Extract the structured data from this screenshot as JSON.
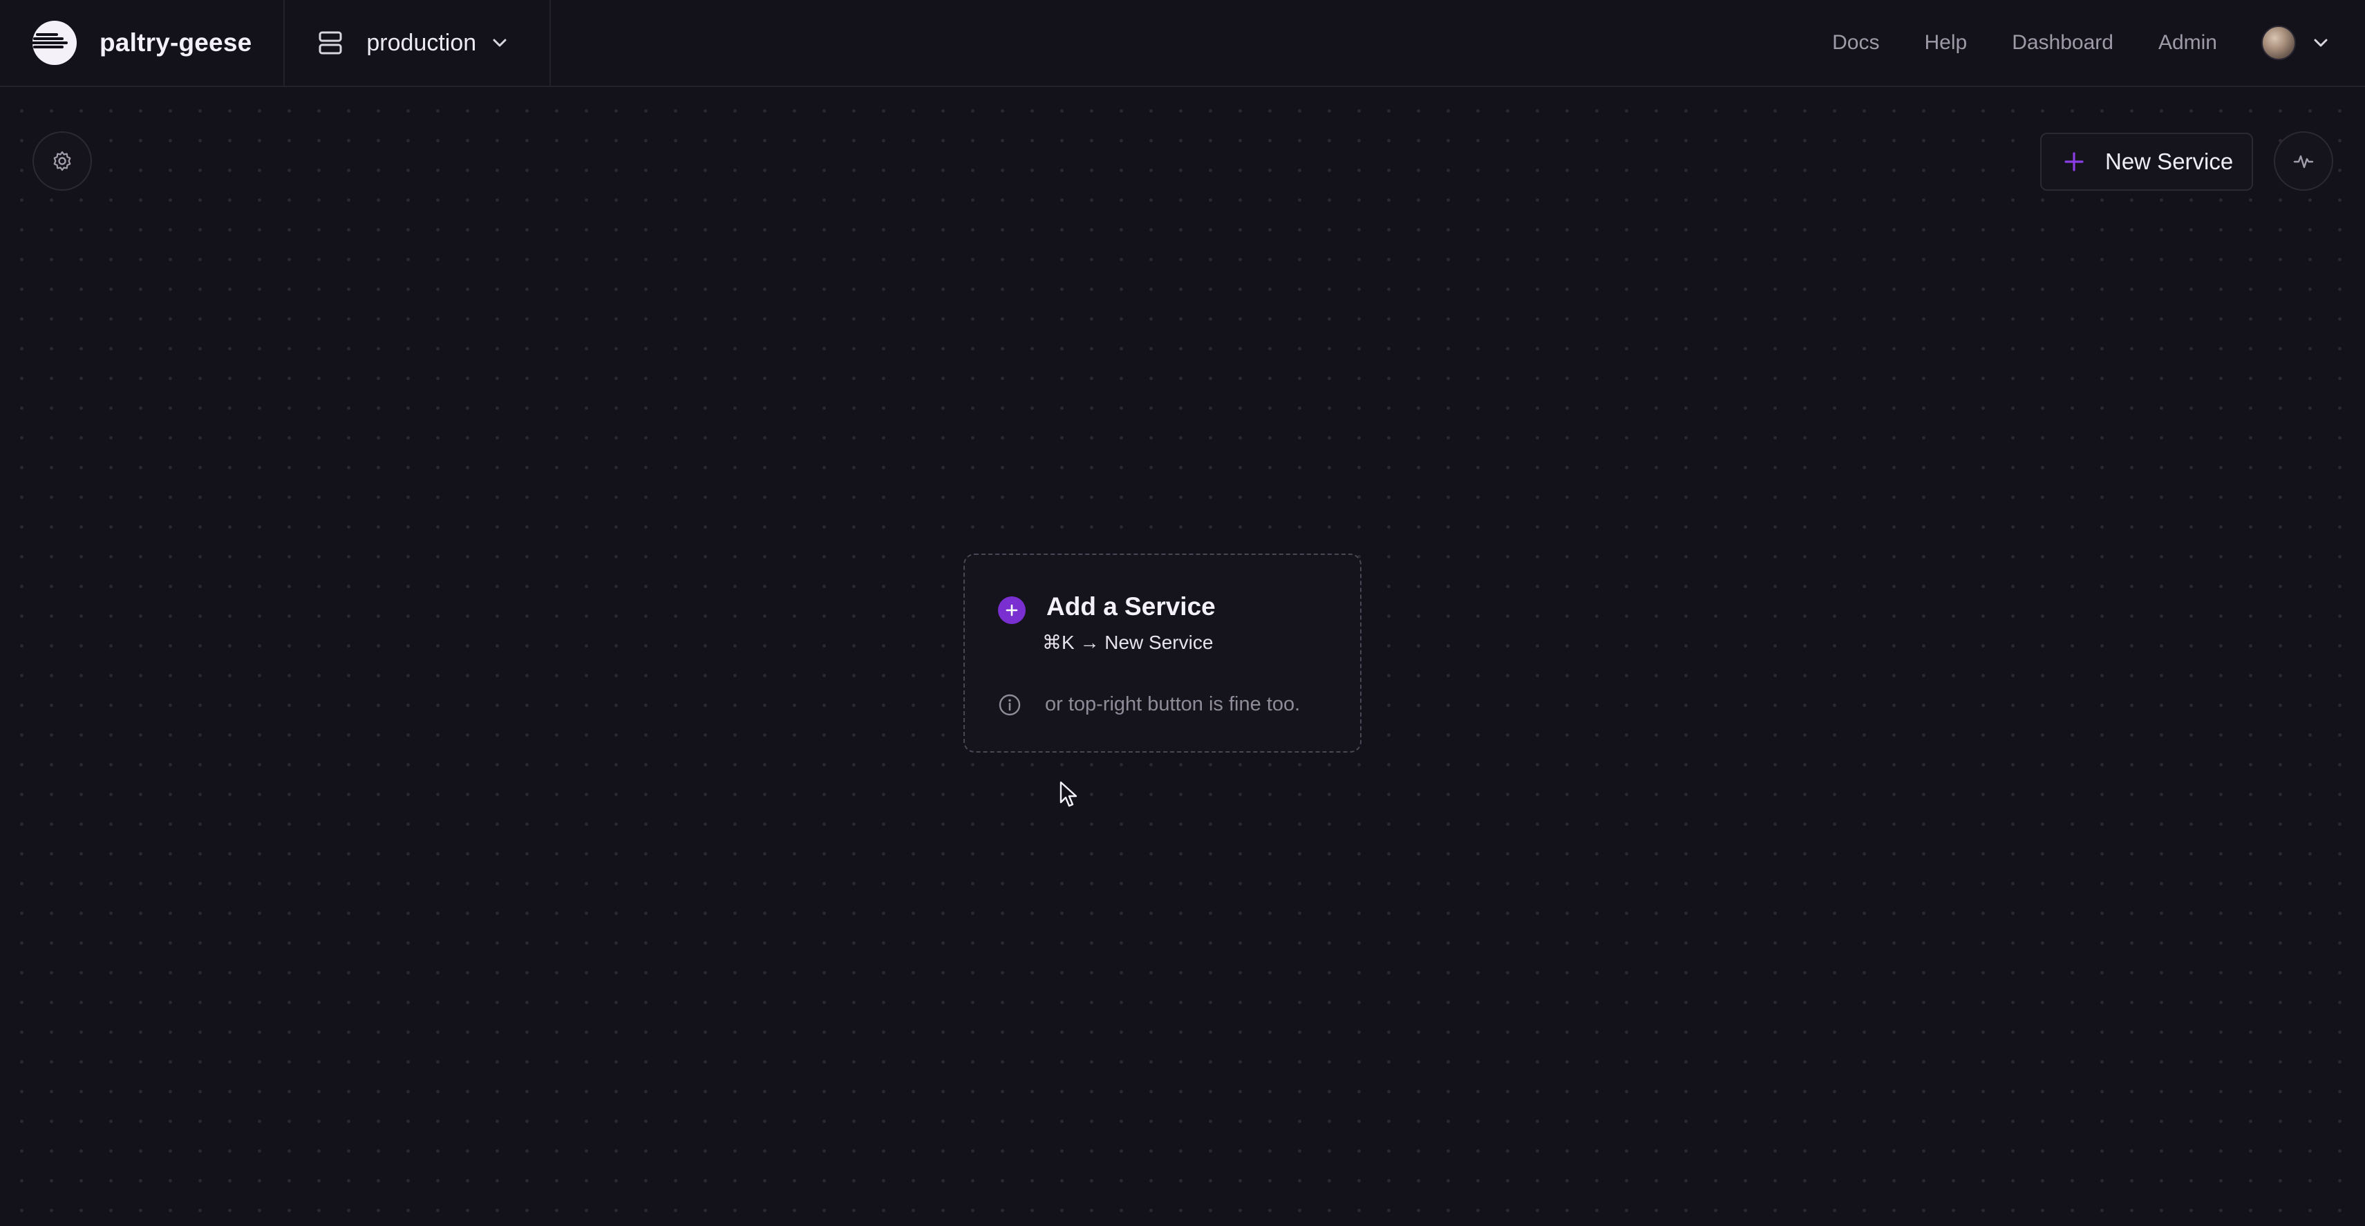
{
  "header": {
    "project_name": "paltry-geese",
    "environment": "production",
    "nav": {
      "docs": "Docs",
      "help": "Help",
      "dashboard": "Dashboard",
      "admin": "Admin"
    }
  },
  "toolbar": {
    "new_service_label": "New Service"
  },
  "empty_state": {
    "title": "Add a Service",
    "shortcut": "⌘K → New Service",
    "hint": "or top-right button is fine too."
  },
  "icons": {
    "logo": "railway-logo-icon",
    "environment": "server-stack-icon",
    "settings": "gear-icon",
    "add": "plus-icon",
    "activity": "activity-pulse-icon",
    "info": "info-circle-icon",
    "chevron": "chevron-down-icon"
  },
  "colors": {
    "background": "#13111a",
    "accent": "#7a2fd1",
    "border": "#2c2934",
    "muted_text": "#9e9aa8"
  }
}
